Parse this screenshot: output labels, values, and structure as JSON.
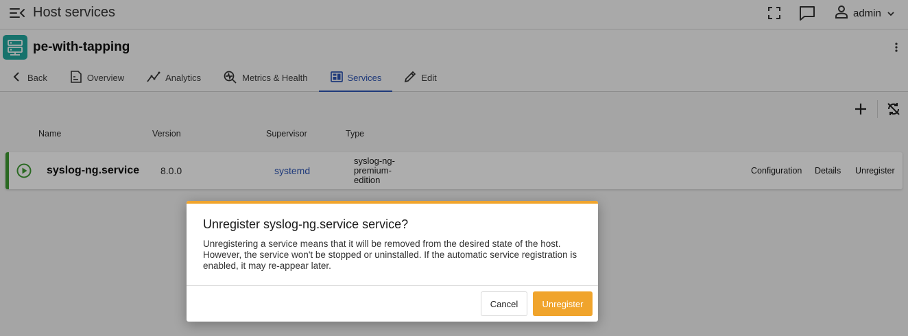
{
  "topbar": {
    "title": "Host services",
    "menu_icon": "menu-collapse-icon",
    "fullscreen_icon": "fullscreen-icon",
    "chat_icon": "chat-icon",
    "user": {
      "name": "admin",
      "icon": "user-icon",
      "chevron": "chevron-down-icon"
    }
  },
  "host": {
    "name": "pe-with-tapping",
    "logo_icon": "server-icon",
    "logo_color": "#23a8a0",
    "menu_icon": "more-vertical-icon"
  },
  "tabs": [
    {
      "label": "Back",
      "icon": "chevron-left-icon"
    },
    {
      "label": "Overview",
      "icon": "document-icon"
    },
    {
      "label": "Analytics",
      "icon": "analytics-icon"
    },
    {
      "label": "Metrics & Health",
      "icon": "metrics-icon"
    },
    {
      "label": "Services",
      "icon": "services-icon",
      "active": true
    },
    {
      "label": "Edit",
      "icon": "pencil-icon"
    }
  ],
  "toolbar": {
    "add_icon": "plus-icon",
    "sync_icon": "sync-disabled-icon"
  },
  "table": {
    "columns": [
      "Name",
      "Version",
      "Supervisor",
      "Type"
    ],
    "rows": [
      {
        "status_icon": "play-circle-icon",
        "status_color": "#3f9b33",
        "name": "syslog-ng.service",
        "version": "8.0.0",
        "supervisor": "systemd",
        "type": "syslog-ng-premium-edition",
        "actions": [
          "Configuration",
          "Details",
          "Unregister"
        ]
      }
    ]
  },
  "dialog": {
    "title": "Unregister syslog-ng.service service?",
    "body": "Unregistering a service means that it will be removed from the desired state of the host. However, the service won't be stopped or uninstalled. If the automatic service registration is enabled, it may re-appear later.",
    "cancel_label": "Cancel",
    "confirm_label": "Unregister",
    "accent_color": "#f0a42c"
  },
  "colors": {
    "link": "#2d55b4",
    "active_tab": "#2d55b4"
  }
}
